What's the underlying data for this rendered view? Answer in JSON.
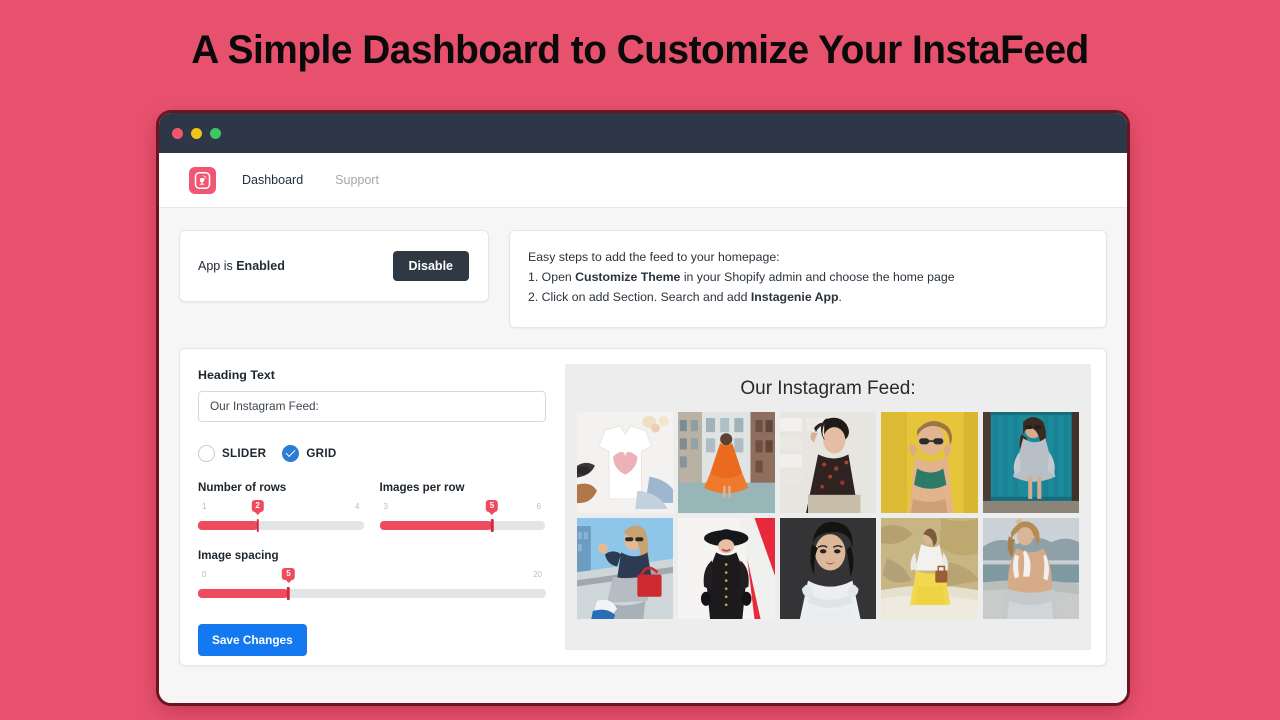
{
  "banner": {
    "title": "A Simple Dashboard to Customize Your InstaFeed",
    "bg_color": "#e8516e"
  },
  "window": {
    "dots": [
      "close-red",
      "minimize-yellow",
      "maximize-green"
    ]
  },
  "nav": {
    "logo_name": "instagenie-logo",
    "links": [
      {
        "label": "Dashboard",
        "active": true
      },
      {
        "label": "Support",
        "active": false
      }
    ]
  },
  "status_card": {
    "prefix": "App is ",
    "state": "Enabled",
    "button_label": "Disable",
    "button_color": "#2f3944"
  },
  "steps_card": {
    "intro": "Easy steps to add the feed to your homepage:",
    "step1_pre": "1. Open ",
    "step1_bold": "Customize Theme",
    "step1_post": " in your Shopify admin and choose the home page",
    "step2_pre": "2. Click on add Section. Search and add ",
    "step2_bold": "Instagenie App",
    "step2_post": "."
  },
  "settings": {
    "heading_label": "Heading Text",
    "heading_value": "Our Instagram Feed:",
    "heading_placeholder": "Our Instagram Feed:",
    "layout_options": [
      {
        "label": "SLIDER",
        "selected": false
      },
      {
        "label": "GRID",
        "selected": true
      }
    ],
    "sliders": [
      {
        "name": "number-of-rows",
        "title": "Number of rows",
        "min": "1",
        "max": "4",
        "value": "2",
        "percent": 36
      },
      {
        "name": "images-per-row",
        "title": "Images per row",
        "min": "3",
        "max": "6",
        "value": "5",
        "percent": 68
      },
      {
        "name": "image-spacing",
        "title": "Image spacing",
        "min": "0",
        "max": "20",
        "value": "5",
        "percent": 26
      }
    ],
    "save_label": "Save Changes",
    "save_color": "#1479f0"
  },
  "preview": {
    "heading": "Our Instagram Feed:",
    "rows": 2,
    "columns": 5,
    "items": [
      {
        "name": "feed-image-white-tshirt-flatlay",
        "alt": "white t-shirt with pink heart flat lay"
      },
      {
        "name": "feed-image-orange-dress-street",
        "alt": "woman in orange dress on city street"
      },
      {
        "name": "feed-image-floral-top-wall",
        "alt": "woman in dark floral top against white wall"
      },
      {
        "name": "feed-image-yellow-backdrop",
        "alt": "woman with sunglasses on yellow backdrop"
      },
      {
        "name": "feed-image-teal-door",
        "alt": "woman in grey dress by teal door"
      },
      {
        "name": "feed-image-streetwear-red-bag",
        "alt": "woman in streetwear with red bag"
      },
      {
        "name": "feed-image-black-hat-coat",
        "alt": "woman in black hat and coat on red backdrop"
      },
      {
        "name": "feed-image-white-ruffle-portrait",
        "alt": "portrait of woman in white ruffle top"
      },
      {
        "name": "feed-image-yellow-skirt-cliff",
        "alt": "woman in yellow skirt by rocky cliff"
      },
      {
        "name": "feed-image-backless-lake",
        "alt": "woman in backless white top by lake"
      }
    ]
  }
}
